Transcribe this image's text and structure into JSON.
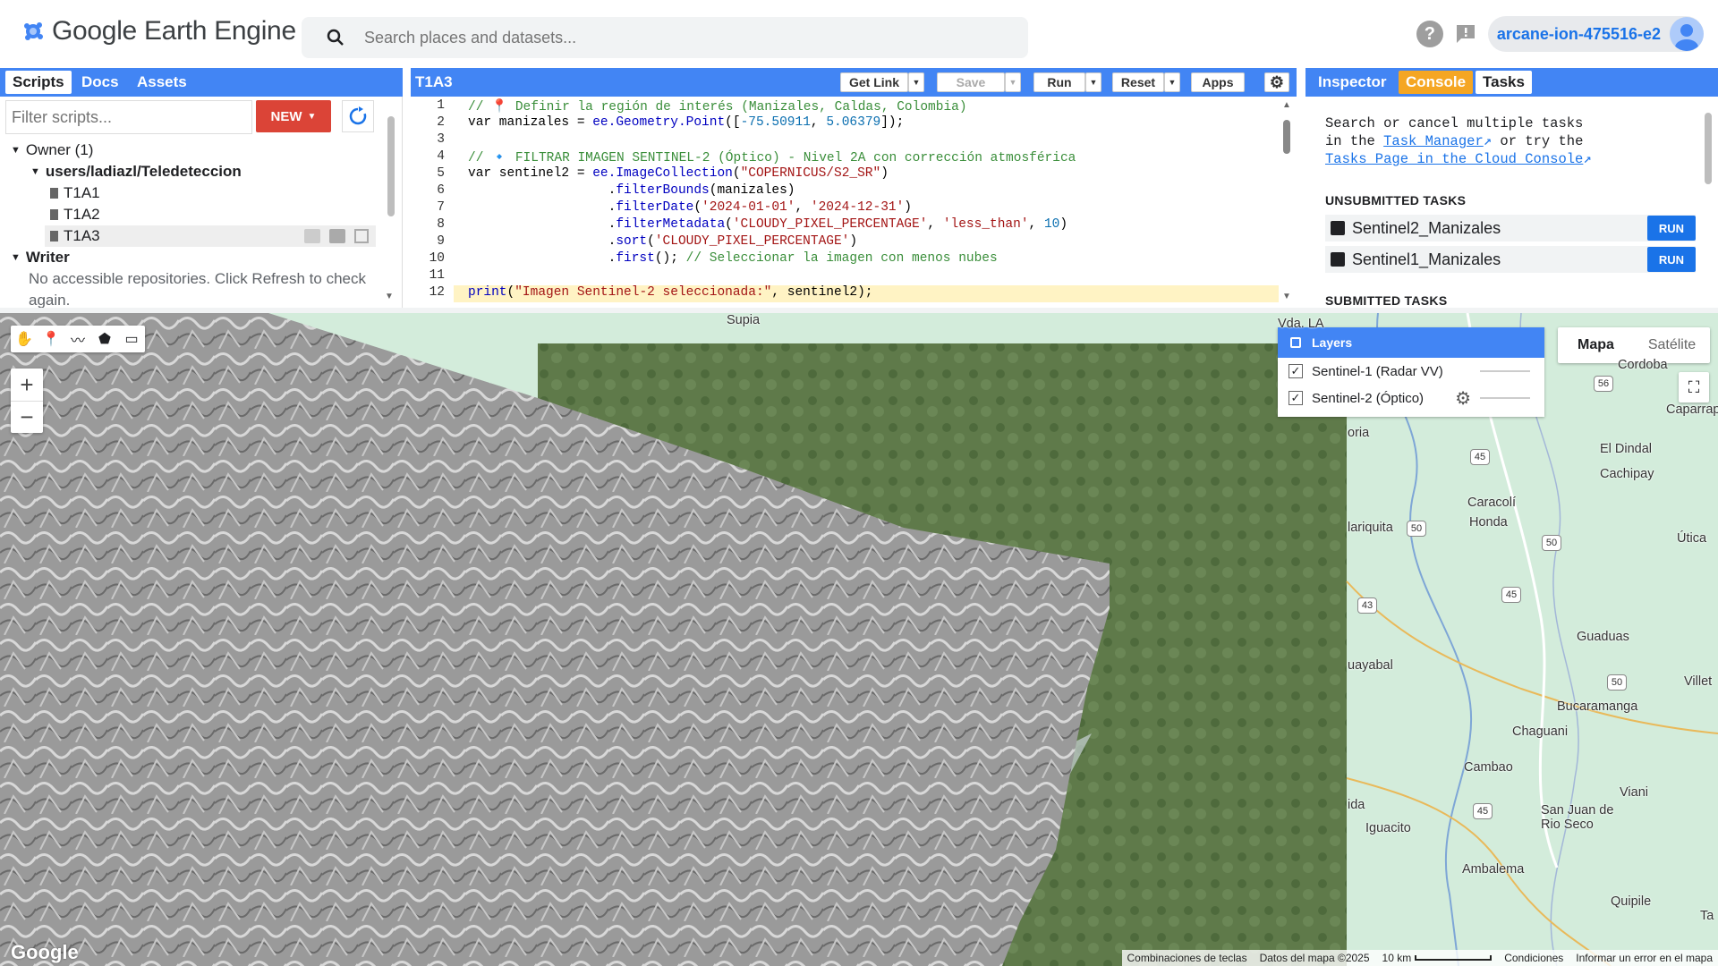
{
  "app": {
    "title": "Google Earth Engine",
    "search_placeholder": "Search places and datasets...",
    "project": "arcane-ion-475516-e2"
  },
  "left_panel": {
    "tabs": [
      "Scripts",
      "Docs",
      "Assets"
    ],
    "filter_placeholder": "Filter scripts...",
    "new_label": "NEW",
    "owner_label": "Owner (1)",
    "repo": "users/ladiazl/Teledeteccion",
    "files": [
      "T1A1",
      "T1A2",
      "T1A3"
    ],
    "writer_label": "Writer",
    "writer_msg_1": "No accessible repositories. Click Refresh to check",
    "writer_msg_2": "again."
  },
  "editor": {
    "script_name": "T1A3",
    "buttons": {
      "get_link": "Get Link",
      "save": "Save",
      "run": "Run",
      "reset": "Reset",
      "apps": "Apps"
    },
    "lines": [
      {
        "n": "1",
        "parts": [
          [
            "cm",
            "// 📍 Definir la región de interés (Manizales, Caldas, Colombia)"
          ]
        ]
      },
      {
        "n": "2",
        "parts": [
          [
            "kw",
            "var"
          ],
          [
            "ct",
            " manizales = "
          ],
          [
            "fn",
            "ee.Geometry.Point"
          ],
          [
            "ct",
            "(["
          ],
          [
            "num",
            "-75.50911"
          ],
          [
            "ct",
            ", "
          ],
          [
            "num",
            "5.06379"
          ],
          [
            "ct",
            "]);"
          ]
        ]
      },
      {
        "n": "3",
        "parts": []
      },
      {
        "n": "4",
        "parts": [
          [
            "cm",
            "// 🔹 FILTRAR IMAGEN SENTINEL-2 (Óptico) - Nivel 2A con corrección atmosférica"
          ]
        ]
      },
      {
        "n": "5",
        "parts": [
          [
            "kw",
            "var"
          ],
          [
            "ct",
            " sentinel2 = "
          ],
          [
            "fn",
            "ee.ImageCollection"
          ],
          [
            "ct",
            "("
          ],
          [
            "str",
            "\"COPERNICUS/S2_SR\""
          ],
          [
            "ct",
            ")"
          ]
        ]
      },
      {
        "n": "6",
        "parts": [
          [
            "ct",
            "                  ."
          ],
          [
            "fn",
            "filterBounds"
          ],
          [
            "ct",
            "(manizales)"
          ]
        ]
      },
      {
        "n": "7",
        "parts": [
          [
            "ct",
            "                  ."
          ],
          [
            "fn",
            "filterDate"
          ],
          [
            "ct",
            "("
          ],
          [
            "str",
            "'2024-01-01'"
          ],
          [
            "ct",
            ", "
          ],
          [
            "str",
            "'2024-12-31'"
          ],
          [
            "ct",
            ")"
          ]
        ]
      },
      {
        "n": "8",
        "parts": [
          [
            "ct",
            "                  ."
          ],
          [
            "fn",
            "filterMetadata"
          ],
          [
            "ct",
            "("
          ],
          [
            "str",
            "'CLOUDY_PIXEL_PERCENTAGE'"
          ],
          [
            "ct",
            ", "
          ],
          [
            "str",
            "'less_than'"
          ],
          [
            "ct",
            ", "
          ],
          [
            "num",
            "10"
          ],
          [
            "ct",
            ")"
          ]
        ]
      },
      {
        "n": "9",
        "parts": [
          [
            "ct",
            "                  ."
          ],
          [
            "fn",
            "sort"
          ],
          [
            "ct",
            "("
          ],
          [
            "str",
            "'CLOUDY_PIXEL_PERCENTAGE'"
          ],
          [
            "ct",
            ")"
          ]
        ]
      },
      {
        "n": "10",
        "parts": [
          [
            "ct",
            "                  ."
          ],
          [
            "fn",
            "first"
          ],
          [
            "ct",
            "(); "
          ],
          [
            "cm",
            "// Seleccionar la imagen con menos nubes"
          ]
        ]
      },
      {
        "n": "11",
        "parts": []
      },
      {
        "n": "12",
        "parts": [
          [
            "fn",
            "print"
          ],
          [
            "ct",
            "("
          ],
          [
            "str",
            "\"Imagen Sentinel-2 seleccionada:\""
          ],
          [
            "ct",
            ", sentinel2);"
          ]
        ]
      }
    ]
  },
  "right_panel": {
    "tabs": [
      "Inspector",
      "Console",
      "Tasks"
    ],
    "msg_1": "Search or cancel multiple tasks",
    "msg_2a": "in the ",
    "msg_2_link": "Task Manager",
    "msg_2b": " or try the",
    "msg_3_link": "Tasks Page in the Cloud Console",
    "unsubmitted_h": "UNSUBMITTED TASKS",
    "tasks": [
      "Sentinel2_Manizales",
      "Sentinel1_Manizales"
    ],
    "run_label": "RUN",
    "submitted_h": "SUBMITTED TASKS"
  },
  "map": {
    "layers_title": "Layers",
    "layers": [
      "Sentinel-1 (Radar VV)",
      "Sentinel-2 (Óptico)"
    ],
    "map_types": [
      "Mapa",
      "Satélite"
    ],
    "places": [
      "Supia",
      "Vda. LA",
      "Cordoba",
      "Caparrapí",
      "oria",
      "El Dindal",
      "Cachipay",
      "Caracolí",
      "Honda",
      "lariquita",
      "Útica",
      "Guaduas",
      "uayabal",
      "Villet",
      "Bucaramanga",
      "Chaguani",
      "Cambao",
      "Viani",
      "San Juan de",
      "Rio Seco",
      "Iguacito",
      "ida",
      "Ambalema",
      "Quipile",
      "Ta"
    ],
    "attribution": [
      "Combinaciones de teclas",
      "Datos del mapa ©2025",
      "10 km",
      "Condiciones",
      "Informar un error en el mapa"
    ],
    "google_logo": "Google"
  }
}
